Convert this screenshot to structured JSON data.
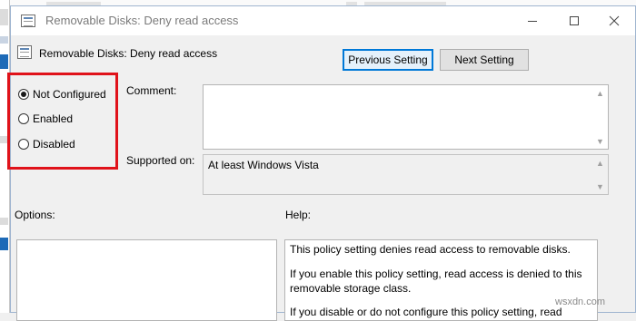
{
  "dialog": {
    "title": "Removable Disks: Deny read access",
    "header": "Removable Disks: Deny read access"
  },
  "buttons": {
    "previous": "Previous Setting",
    "next": "Next Setting"
  },
  "radios": {
    "selected": "Not Configured",
    "options": [
      "Not Configured",
      "Enabled",
      "Disabled"
    ]
  },
  "comment": {
    "label": "Comment:",
    "value": ""
  },
  "supported": {
    "label": "Supported on:",
    "value": "At least Windows Vista"
  },
  "options": {
    "label": "Options:"
  },
  "help": {
    "label": "Help:",
    "paragraphs": [
      "This policy setting denies read access to removable disks.",
      "If you enable this policy setting, read access is denied to this removable storage class.",
      "If you disable or do not configure this policy setting, read access"
    ]
  },
  "watermark": "wsxdn.com",
  "colors": {
    "highlight": "#e0121a",
    "focus_border": "#0078d7"
  },
  "icons": {
    "title": "policy-icon",
    "minimize": "minimize-icon",
    "maximize": "maximize-icon",
    "close": "close-icon"
  }
}
